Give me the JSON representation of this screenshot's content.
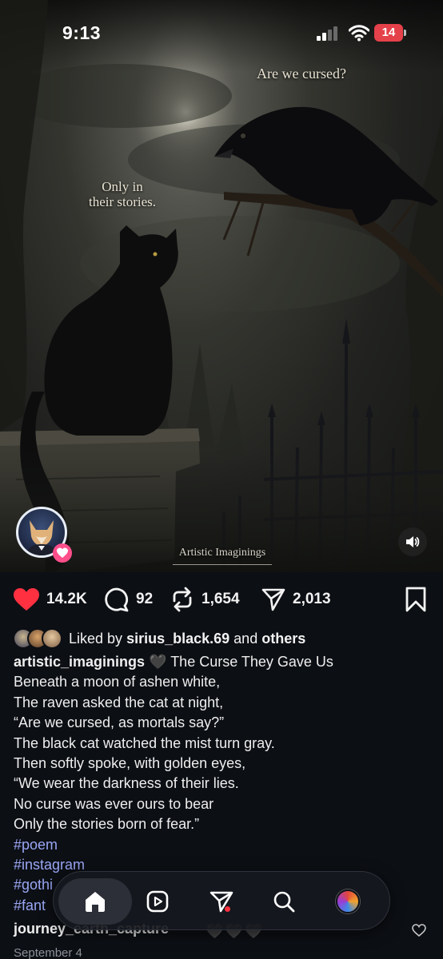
{
  "status_bar": {
    "time": "9:13",
    "battery_level": "14",
    "colors": {
      "battery": "#e5414a"
    }
  },
  "post_image": {
    "captions": {
      "raven": "Are we cursed?",
      "cat_line1": "Only in",
      "cat_line2": "their stories."
    },
    "watermark": "Artistic Imaginings"
  },
  "actions": {
    "likes": "14.2K",
    "comments": "92",
    "reposts": "1,654",
    "shares": "2,013",
    "colors": {
      "like_active": "#ff3040"
    }
  },
  "likes_summary": {
    "prefix": "Liked by",
    "user": "sirius_black.69",
    "joiner": "and",
    "others": "others"
  },
  "caption": {
    "username": "artistic_imaginings",
    "emoji": "🖤",
    "title": "The Curse They Gave Us",
    "lines": [
      "Beneath a moon of ashen white,",
      "The raven asked the cat at night,",
      "“Are we cursed, as mortals say?”",
      "The black cat watched the mist turn gray.",
      "Then softly spoke, with golden eyes,",
      "“We wear the darkness of their lies.",
      "No curse was ever ours to bear",
      "Only the stories born of fear.”"
    ],
    "hashtags": [
      "#poem",
      "#instagram",
      "#gothi",
      "#fant"
    ],
    "colors": {
      "hashtag": "#9aa6f4"
    }
  },
  "comment_preview": {
    "username": "journey_earth_capture",
    "hearts": "🖤🖤🖤",
    "date": "September 4"
  },
  "bottom_nav": {
    "items": [
      "home-icon",
      "reels-icon",
      "direct-share-icon",
      "search-icon",
      "profile-avatar"
    ],
    "active": "home-icon"
  }
}
